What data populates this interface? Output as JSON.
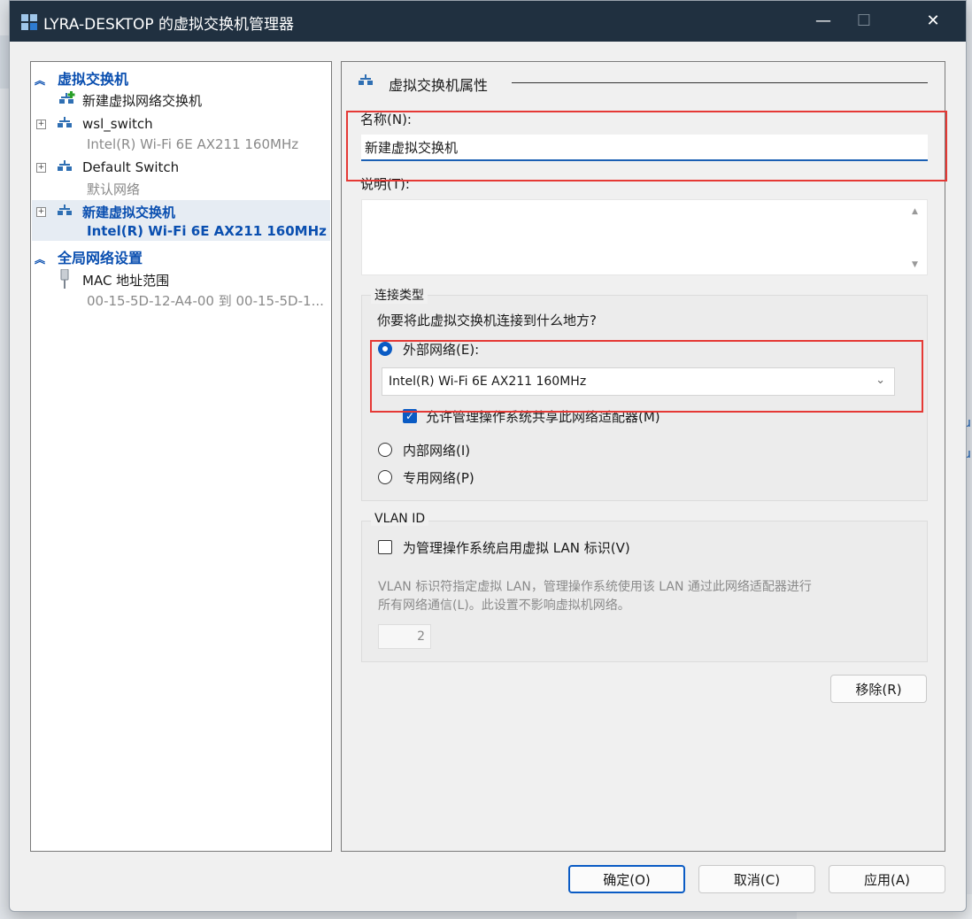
{
  "window": {
    "title": "LYRA-DESKTOP 的虚拟交换机管理器"
  },
  "tree": {
    "section_switches": "虚拟交换机",
    "new_switch": "新建虚拟网络交换机",
    "items": [
      {
        "name": "wsl_switch",
        "sub": "Intel(R) Wi-Fi 6E AX211 160MHz"
      },
      {
        "name": "Default Switch",
        "sub": "默认网络"
      },
      {
        "name": "新建虚拟交换机",
        "sub": "Intel(R) Wi-Fi 6E AX211 160MHz"
      }
    ],
    "section_global": "全局网络设置",
    "mac": {
      "name": "MAC 地址范围",
      "sub": "00-15-5D-12-A4-00 到 00-15-5D-1..."
    }
  },
  "panel": {
    "heading": "虚拟交换机属性",
    "name_label": "名称(N):",
    "name_value": "新建虚拟交换机",
    "notes_label": "说明(T):",
    "conn_group": "连接类型",
    "conn_question": "你要将此虚拟交换机连接到什么地方?",
    "external": "外部网络(E):",
    "adapter": "Intel(R) Wi-Fi 6E AX211 160MHz",
    "allow_share": "允许管理操作系统共享此网络适配器(M)",
    "internal": "内部网络(I)",
    "private": "专用网络(P)",
    "vlan_group": "VLAN ID",
    "vlan_enable": "为管理操作系统启用虚拟 LAN 标识(V)",
    "vlan_desc1": "VLAN 标识符指定虚拟 LAN，管理操作系统使用该 LAN 通过此网络适配器进行",
    "vlan_desc2": "所有网络通信(L)。此设置不影响虚拟机网络。",
    "vlan_value": "2",
    "remove": "移除(R)"
  },
  "footer": {
    "ok": "确定(O)",
    "cancel": "取消(C)",
    "apply": "应用(A)"
  },
  "colors": {
    "accent": "#0a5bc4",
    "highlight": "#e53935",
    "titlebar": "#203040"
  }
}
